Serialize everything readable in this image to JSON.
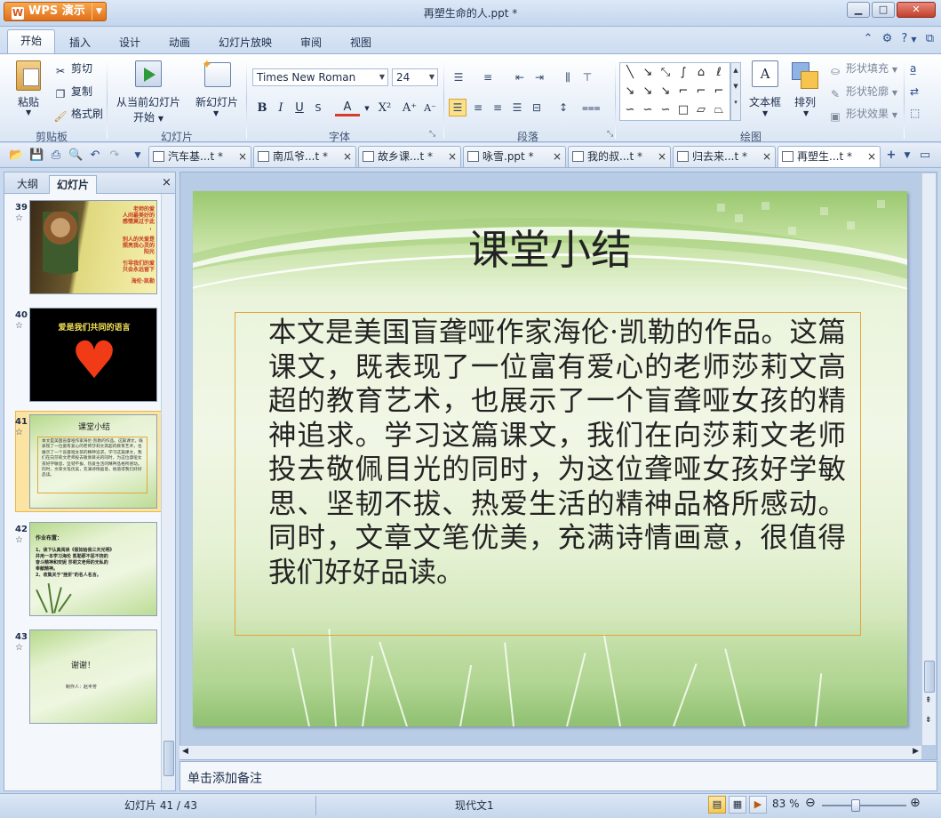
{
  "app": {
    "name": "WPS 演示",
    "window_title": "再塑生命的人.ppt *",
    "logo_letter": "W"
  },
  "menu": {
    "tabs": [
      "开始",
      "插入",
      "设计",
      "动画",
      "幻灯片放映",
      "审阅",
      "视图"
    ]
  },
  "ribbon": {
    "clipboard": {
      "paste": "粘贴",
      "cut": "剪切",
      "copy": "复制",
      "format_painter": "格式刷",
      "label": "剪贴板"
    },
    "slides": {
      "from_current": "从当前幻灯片",
      "from_current_2": "开始",
      "new_slide": "新幻灯片",
      "label": "幻灯片"
    },
    "font": {
      "family": "Times New Roman",
      "size": "24",
      "label": "字体"
    },
    "paragraph": {
      "label": "段落"
    },
    "drawing": {
      "textbox": "文本框",
      "arrange": "排列",
      "shape_fill": "形状填充",
      "shape_outline": "形状轮廓",
      "shape_effect": "形状效果",
      "label": "绘图"
    }
  },
  "doc_tabs": [
    {
      "label": "汽车基...t *"
    },
    {
      "label": "南瓜爷...t *"
    },
    {
      "label": "故乡课...t *"
    },
    {
      "label": "咏雪.ppt *"
    },
    {
      "label": "我的叔...t *"
    },
    {
      "label": "归去来...t *"
    },
    {
      "label": "再塑生...t *",
      "active": true
    }
  ],
  "left_panel": {
    "tab_outline": "大纲",
    "tab_slides": "幻灯片",
    "thumbs": [
      {
        "num": "39",
        "lines": [
          "老师的爱",
          "人间最美好的",
          "感情莫过于此",
          "，",
          "别人的关爱是",
          "照亮我心灵的",
          "阳光",
          "引导我们的爱",
          "只会永远留下",
          "海伦·凯勒"
        ]
      },
      {
        "num": "40",
        "title": "爱是我们共同的语言"
      },
      {
        "num": "41",
        "title": "课堂小结"
      },
      {
        "num": "42",
        "title": "作业布置：",
        "lines": [
          "1、读下认真阅读《假如给我三天光明》",
          "并用一本学习海伦 凯勒那不屈不挠的",
          "奋斗精神和安妮 莎莉文老师的无私的",
          "奉献精神。",
          "2、收集关于\"挫折\"的名人名言。"
        ]
      },
      {
        "num": "43",
        "title": "谢谢！",
        "subtitle": "制作人：赵丰芳"
      }
    ]
  },
  "slide": {
    "title": "课堂小结",
    "body": "本文是美国盲聋哑作家海伦·凯勒的作品。这篇课文，既表现了一位富有爱心的老师莎莉文高超的教育艺术，也展示了一个盲聋哑女孩的精神追求。学习这篇课文，我们在向莎莉文老师投去敬佩目光的同时，为这位聋哑女孩好学敏思、坚韧不拔、热爱生活的精神品格所感动。同时，文章文笔优美，充满诗情画意，很值得我们好好品读。"
  },
  "notes": {
    "placeholder": "单击添加备注"
  },
  "status": {
    "slide_info": "幻灯片 41 / 43",
    "theme": "现代文1",
    "zoom": "83 %",
    "zoom_level": 0.4
  },
  "colors": {
    "accent_orange": "#e0701a",
    "frame_orange": "#e3a63b",
    "ribbon_blue": "#9ab2d3"
  }
}
